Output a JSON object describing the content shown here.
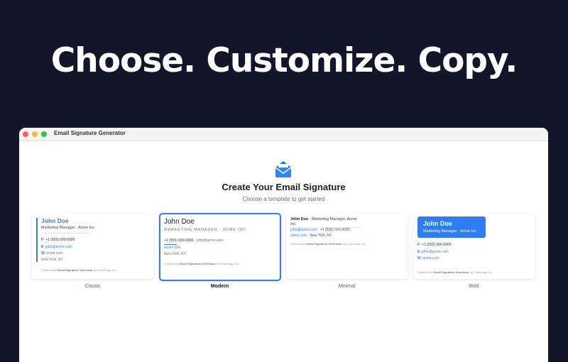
{
  "hero": {
    "title": "Choose. Customize. Copy."
  },
  "window": {
    "title": "Email Signature Generator"
  },
  "app": {
    "title": "Create Your Email Signature",
    "subtitle": "Choose a template to get started"
  },
  "colors": {
    "accent": "#2f7df6",
    "background": "#121628"
  },
  "templates": {
    "classic": {
      "name": "Classic",
      "person": "John Doe",
      "role_line": "Marketing Manager · Acme Inc.",
      "phone_label": "P:",
      "phone": "+1 (555) 000-0000",
      "email_label": "E:",
      "email": "john@acme.com",
      "web_label": "W:",
      "web": "acme.com",
      "location": "New York, NY",
      "powered_prefix": "Powered by",
      "powered_name": "Email Signature Generator",
      "powered_suffix": "by Futurelogy, Inc."
    },
    "modern": {
      "name": "Modern",
      "person": "John Doe",
      "role_line": "MARKETING MANAGER · ACME INC.",
      "phone": "+1 (555) 000-0000",
      "email": "john@acme.com",
      "web": "acme.com",
      "location": "New York, NY",
      "powered_prefix": "Powered by",
      "powered_name": "Email Signature Generator",
      "powered_suffix": "by Futurelogy, Inc."
    },
    "minimal": {
      "name": "Minimal",
      "person": "John Doe",
      "role_line": "· Marketing Manager, Acme",
      "role_cont": "Inc.",
      "email": "john@acme.com",
      "phone": "· +1 (555) 000-0000",
      "web": "acme.com",
      "location": "· New York, NY",
      "powered_prefix": "Powered by",
      "powered_name": "Email Signature Generator",
      "powered_suffix": "by Futurelogy, Inc."
    },
    "bold": {
      "name": "Bold",
      "person": "John Doe",
      "role_line": "Marketing Manager · Acme Inc.",
      "phone_label": "P:",
      "phone": "+1 (555) 000-0000",
      "email_label": "E:",
      "email": "john@acme.com",
      "web_label": "W:",
      "web": "acme.com",
      "location": "New York, NY",
      "powered_prefix": "Powered by",
      "powered_name": "Email Signature Generator",
      "powered_suffix": "by Futurelogy, Inc."
    }
  }
}
